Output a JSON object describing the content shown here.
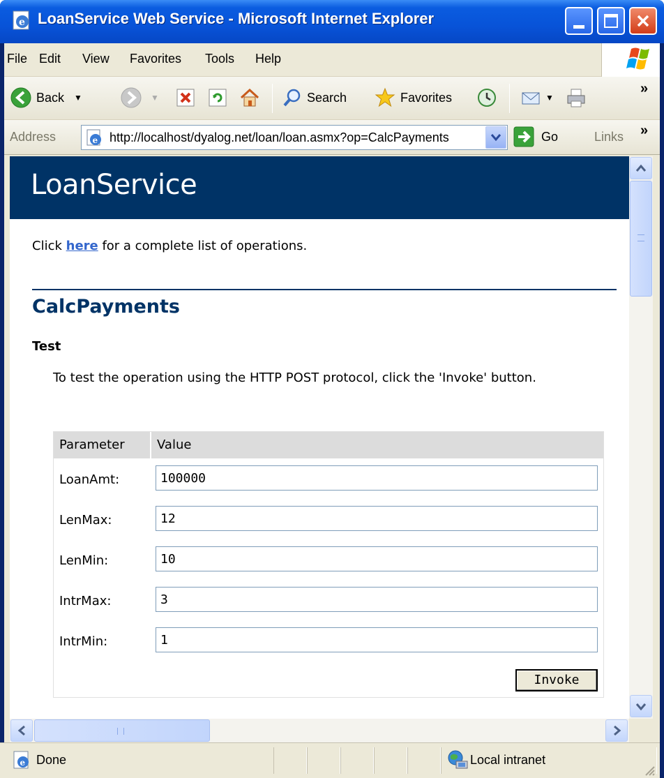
{
  "window": {
    "title": "LoanService Web Service - Microsoft Internet Explorer"
  },
  "menu": {
    "items": [
      "File",
      "Edit",
      "View",
      "Favorites",
      "Tools",
      "Help"
    ]
  },
  "toolbar": {
    "back_label": "Back",
    "search_label": "Search",
    "favorites_label": "Favorites",
    "overflow": "»"
  },
  "addressbar": {
    "label": "Address",
    "url": "http://localhost/dyalog.net/loan/loan.asmx?op=CalcPayments",
    "go_label": "Go",
    "links_label": "Links",
    "overflow": "»"
  },
  "page": {
    "heading": "LoanService",
    "intro_before": "Click ",
    "intro_link": "here",
    "intro_after": " for a complete list of operations.",
    "operation_title": "CalcPayments",
    "test_heading": "Test",
    "test_description": "To test the operation using the HTTP POST protocol, click the 'Invoke' button.",
    "form": {
      "header_parameter": "Parameter",
      "header_value": "Value",
      "params": [
        {
          "label": "LoanAmt:",
          "value": "100000"
        },
        {
          "label": "LenMax:",
          "value": "12"
        },
        {
          "label": "LenMin:",
          "value": "10"
        },
        {
          "label": "IntrMax:",
          "value": "3"
        },
        {
          "label": "IntrMin:",
          "value": "1"
        }
      ],
      "invoke_label": "Invoke"
    }
  },
  "statusbar": {
    "status": "Done",
    "zone": "Local intranet"
  },
  "colors": {
    "title_bar": "#0853d8",
    "banner": "#003366",
    "link": "#3366cc",
    "chrome": "#ece9d8"
  }
}
